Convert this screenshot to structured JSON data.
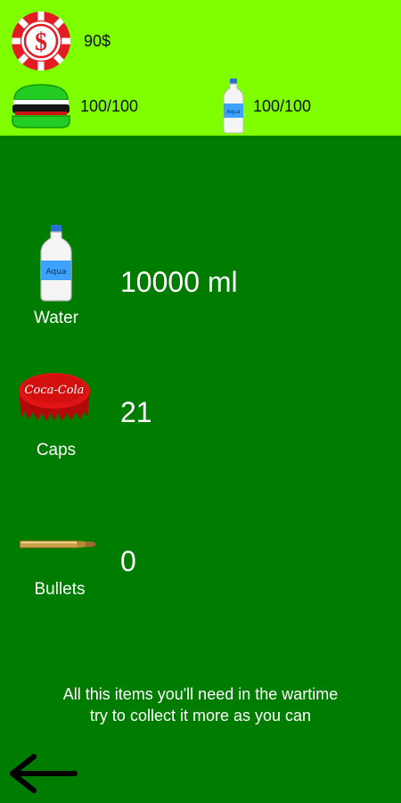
{
  "hud": {
    "money": "90$",
    "food": "100/100",
    "drink": "100/100"
  },
  "bottle_label": "Aqua",
  "cap_label": "Coca-Cola",
  "items": [
    {
      "label": "Water",
      "value": "10000 ml",
      "icon": "water-bottle-icon"
    },
    {
      "label": "Caps",
      "value": "21",
      "icon": "bottle-cap-icon"
    },
    {
      "label": "Bullets",
      "value": "0",
      "icon": "bullet-icon"
    }
  ],
  "note": {
    "line1": "All this items you'll need in the wartime",
    "line2": "try to collect it more as you can"
  },
  "colors": {
    "topbar": "#7fff00",
    "background": "#007c00",
    "chip": "#e31b23"
  }
}
